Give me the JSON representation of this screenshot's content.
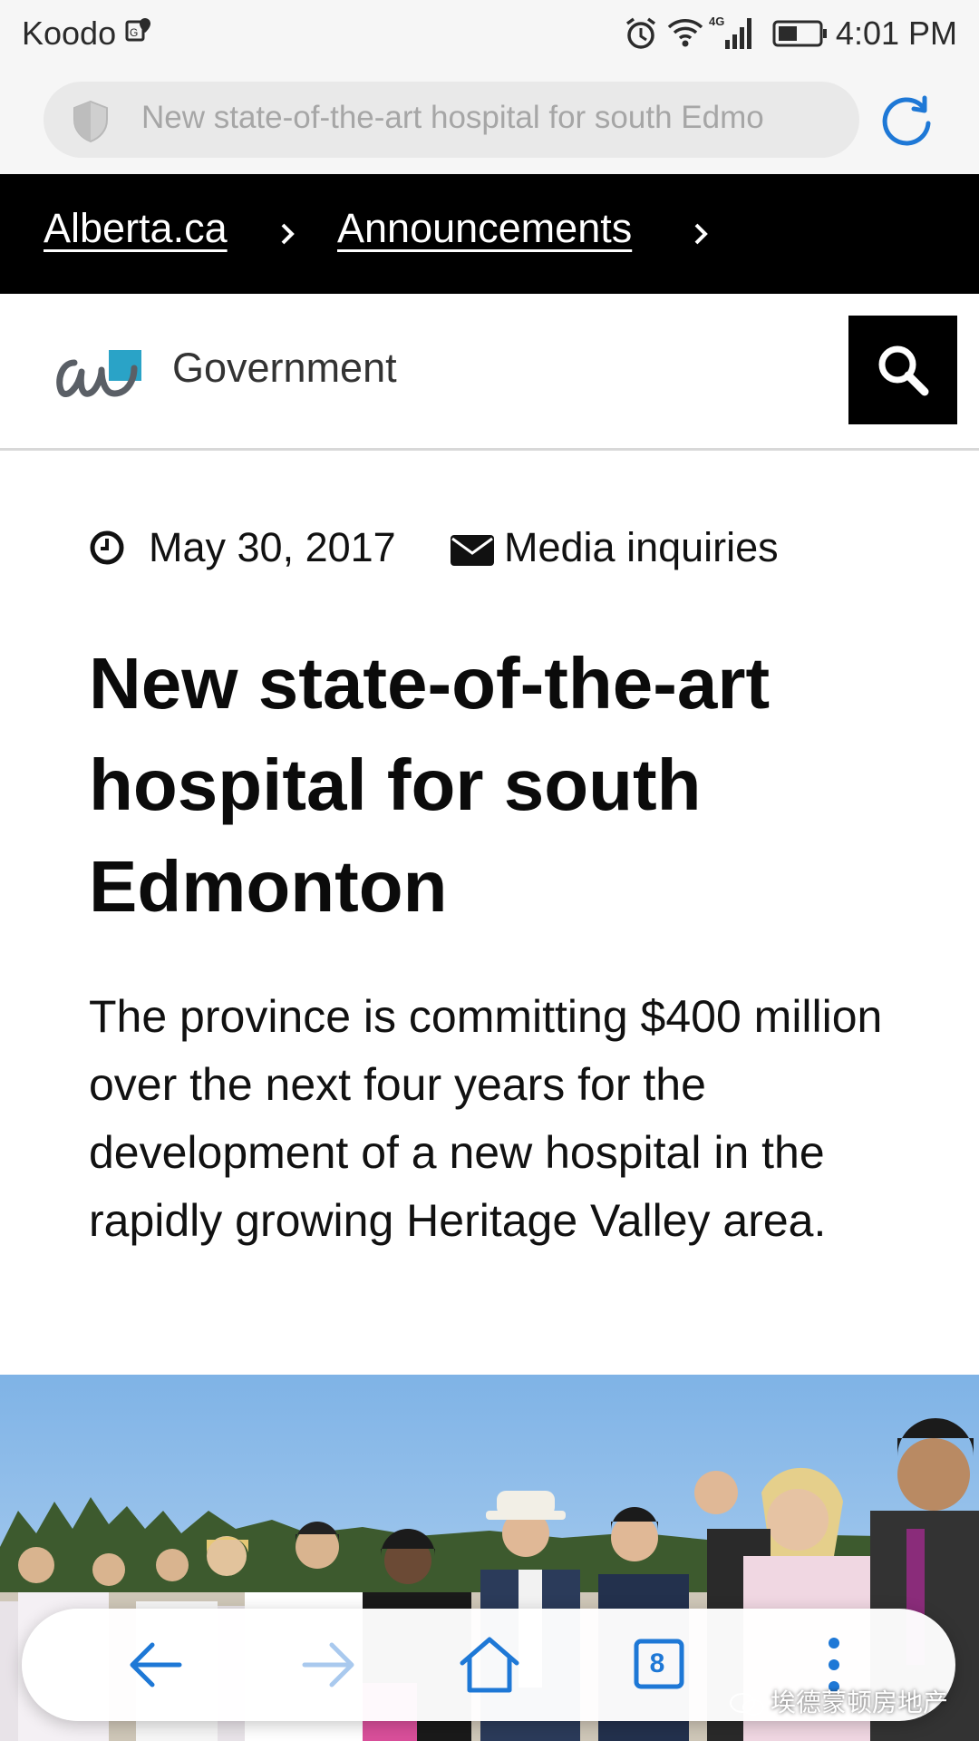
{
  "status_bar": {
    "carrier": "Koodo",
    "time": "4:01 PM",
    "icons": [
      "location-icon",
      "alarm-icon",
      "wifi-icon",
      "signal-4g-icon",
      "battery-icon"
    ]
  },
  "browser": {
    "url": "New state-of-the-art hospital for south Edmo",
    "tab_count": "8"
  },
  "breadcrumb": {
    "items": [
      "Alberta.ca",
      "Announcements"
    ]
  },
  "site_header": {
    "label": "Government"
  },
  "article": {
    "date": "May 30, 2017",
    "media_link": "Media inquiries",
    "title": "New state-of-the-art hospital for south Edmonton",
    "lead": "The province is committing $400 million over the next four years for the development of a new hospital in the rapidly growing Heritage Valley area."
  },
  "watermark": "埃德蒙顿房地产",
  "colors": {
    "accent": "#1e78d6",
    "breadcrumb_bg": "#000000",
    "logo_teal": "#2aa3c7"
  }
}
